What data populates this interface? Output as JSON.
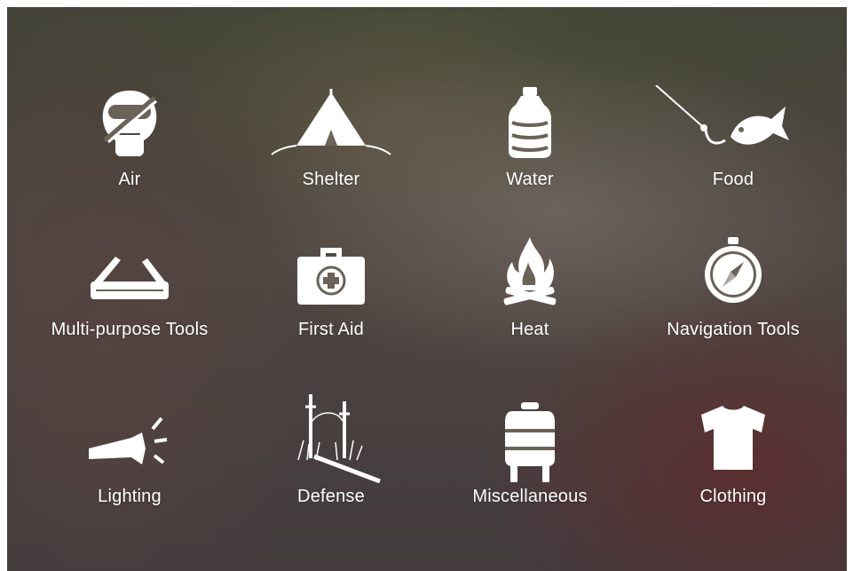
{
  "categories": [
    {
      "label": "Air",
      "icon": "gas-mask-icon"
    },
    {
      "label": "Shelter",
      "icon": "tent-icon"
    },
    {
      "label": "Water",
      "icon": "water-jug-icon"
    },
    {
      "label": "Food",
      "icon": "fishing-hook-fish-icon"
    },
    {
      "label": "Multi-purpose Tools",
      "icon": "pocket-knife-icon"
    },
    {
      "label": "First Aid",
      "icon": "first-aid-kit-icon"
    },
    {
      "label": "Heat",
      "icon": "campfire-icon"
    },
    {
      "label": "Navigation Tools",
      "icon": "compass-icon"
    },
    {
      "label": "Lighting",
      "icon": "flashlight-icon"
    },
    {
      "label": "Defense",
      "icon": "trap-icon"
    },
    {
      "label": "Miscellaneous",
      "icon": "backpack-icon"
    },
    {
      "label": "Clothing",
      "icon": "t-shirt-icon"
    }
  ],
  "colors": {
    "icon": "#ffffff",
    "text": "#ffffff",
    "overlay": "#141414"
  }
}
